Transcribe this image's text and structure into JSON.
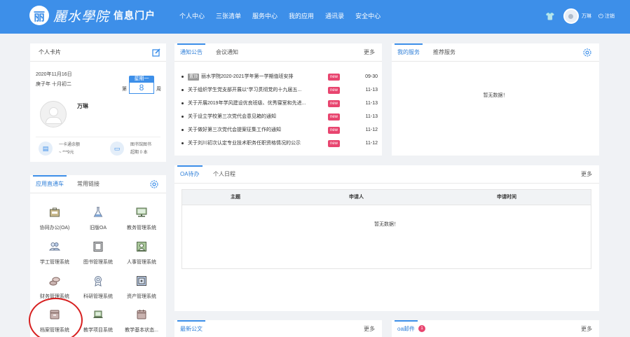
{
  "header": {
    "logo_mark": "丽",
    "logo_name": "麗水學院",
    "logo_sub": "信息门户",
    "nav": [
      "个人中心",
      "三张清单",
      "服务中心",
      "我的应用",
      "通讯录",
      "安全中心"
    ],
    "user": "万琳",
    "logout": "注销"
  },
  "personal_card": {
    "title": "个人卡片",
    "date_line1": "2020年11月16日",
    "date_line2": "庚子年 十月初二",
    "week_label": "星期一",
    "week_pre": "第",
    "week_num": "8",
    "week_post": "周",
    "name": "万琳",
    "card_label": "一卡通余额",
    "card_value": "~ ***9元",
    "library_label": "图书馆图书",
    "library_value": "超期 0 本"
  },
  "apps_card": {
    "tabs": [
      "应用直通车",
      "常用链接"
    ],
    "items": [
      {
        "label": "协同办公(OA)",
        "icon": "briefcase-icon"
      },
      {
        "label": "旧版OA",
        "icon": "flask-icon"
      },
      {
        "label": "教务管理系统",
        "icon": "monitor-icon"
      },
      {
        "label": "学工管理系统",
        "icon": "users-icon"
      },
      {
        "label": "图书管理系统",
        "icon": "book-icon"
      },
      {
        "label": "人事管理系统",
        "icon": "person-card-icon"
      },
      {
        "label": "财务管理系统",
        "icon": "coins-icon"
      },
      {
        "label": "科研管理系统",
        "icon": "award-icon"
      },
      {
        "label": "资产管理系统",
        "icon": "safe-icon"
      },
      {
        "label": "档案管理系统",
        "icon": "archive-icon"
      },
      {
        "label": "教学项目系统",
        "icon": "laptop-icon"
      },
      {
        "label": "教学基本状态...",
        "icon": "calendar-icon"
      }
    ]
  },
  "notices_card": {
    "tabs": [
      "通知公告",
      "会议通知"
    ],
    "more": "更多",
    "items": [
      {
        "pin": "置顶",
        "title": "丽水学院2020-2021学年第一学期值班安排",
        "new": "new",
        "date": "09-30"
      },
      {
        "pin": "",
        "title": "关于组织学生党支部开展以“学习贯彻党的十九届五...",
        "new": "new",
        "date": "11-13"
      },
      {
        "pin": "",
        "title": "关于开展2019年学风建设优良班级、优秀寝室和先进...",
        "new": "new",
        "date": "11-13"
      },
      {
        "pin": "",
        "title": "关于设立学校第三次党代会意见箱的通知",
        "new": "new",
        "date": "11-13"
      },
      {
        "pin": "",
        "title": "关于做好第三次党代会提案征集工作的通知",
        "new": "new",
        "date": "11-12"
      },
      {
        "pin": "",
        "title": "关于刘川初次认定专业技术职务任职资格情况的公示",
        "new": "new",
        "date": "11-12"
      }
    ]
  },
  "services_card": {
    "tabs": [
      "我的服务",
      "推荐服务"
    ],
    "empty": "暂无数据！"
  },
  "oa_card": {
    "tabs": [
      "OA待办",
      "个人日程"
    ],
    "more": "更多",
    "columns": [
      "主题",
      "申请人",
      "申请时间"
    ],
    "empty": "暂无数据！"
  },
  "docs_card": {
    "title": "最新公文",
    "more": "更多"
  },
  "mail_card": {
    "title": "oa邮件",
    "badge": "1",
    "more": "更多"
  }
}
